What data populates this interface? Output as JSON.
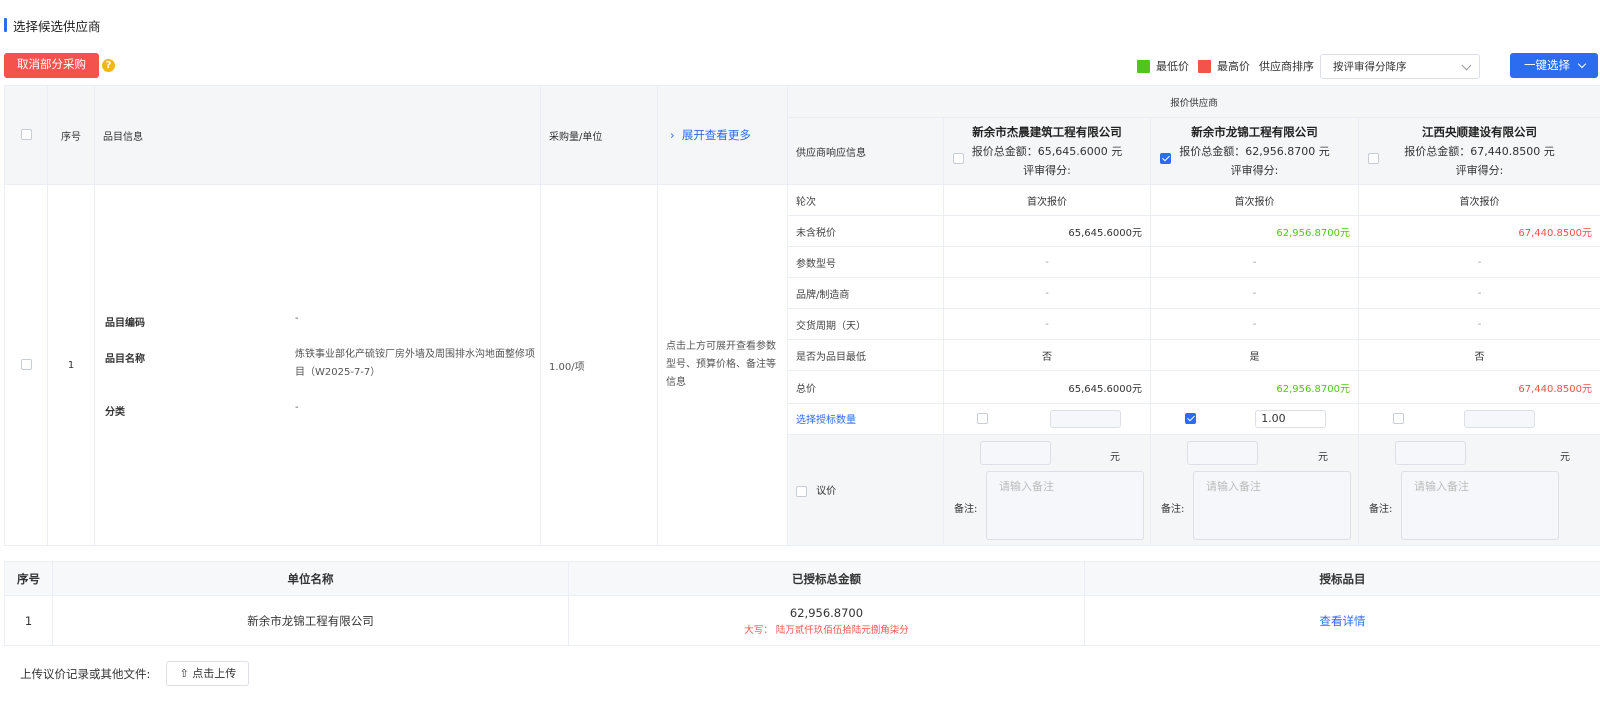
{
  "section_title": "选择候选供应商",
  "toolbar": {
    "cancel_label": "取消部分采购",
    "help_glyph": "?",
    "legend_low": "最低价",
    "legend_high": "最高价",
    "sort_label": "供应商排序",
    "sort_value": "按评审得分降序",
    "one_click_label": "一键选择",
    "colors": {
      "low": "#52c41a",
      "high": "#f4524d",
      "accent": "#2b6cf0"
    }
  },
  "table": {
    "headers": {
      "seq": "序号",
      "item_info": "品目信息",
      "qty_unit": "采购量/单位",
      "expand": "展开查看更多",
      "quote_suppliers": "报价供应商",
      "response_info": "供应商响应信息"
    },
    "suppliers": [
      {
        "name": "新余市杰晨建筑工程有限公司",
        "amount": "报价总金额：65,645.6000 元",
        "score": "评审得分:",
        "selected": false
      },
      {
        "name": "新余市龙锦工程有限公司",
        "amount": "报价总金额：62,956.8700 元",
        "score": "评审得分:",
        "selected": true
      },
      {
        "name": "江西央顺建设有限公司",
        "amount": "报价总金额：67,440.8500 元",
        "score": "评审得分:",
        "selected": false
      }
    ],
    "row": {
      "seq": "1",
      "item_code_label": "品目编码",
      "item_code": "-",
      "item_name_label": "品目名称",
      "item_name": "炼铁事业部化产硫铵厂房外墙及周围排水沟地面整修项目（W2025-7-7）",
      "category_label": "分类",
      "category": "-",
      "qty": "1.00/项",
      "hint": "点击上方可展开查看参数型号、预算价格、备注等信息"
    },
    "detail_rows": [
      {
        "label": "轮次",
        "values": [
          "首次报价",
          "首次报价",
          "首次报价"
        ]
      },
      {
        "label": "未含税价",
        "values": [
          "65,645.6000元",
          "62,956.8700元",
          "67,440.8500元"
        ]
      },
      {
        "label": "参数型号",
        "values": [
          "-",
          "-",
          "-"
        ]
      },
      {
        "label": "品牌/制造商",
        "values": [
          "-",
          "-",
          "-"
        ]
      },
      {
        "label": "交货周期（天）",
        "values": [
          "-",
          "-",
          "-"
        ]
      },
      {
        "label": "是否为品目最低",
        "values": [
          "否",
          "是",
          "否"
        ]
      },
      {
        "label": "总价",
        "values": [
          "65,645.6000元",
          "62,956.8700元",
          "67,440.8500元"
        ]
      }
    ],
    "award_qty_label": "选择授标数量",
    "award_qty_values": [
      "",
      "1.00",
      ""
    ],
    "negotiate_label": "议价",
    "yuan": "元",
    "remark_label": "备注:",
    "remark_placeholder": "请输入备注"
  },
  "summary": {
    "headers": [
      "序号",
      "单位名称",
      "已授标总金额",
      "授标品目"
    ],
    "rows": [
      {
        "seq": "1",
        "company": "新余市龙锦工程有限公司",
        "amount": "62,956.8700",
        "caps": "大写： 陆万贰仟玖佰伍拾陆元捌角柒分",
        "link": "查看详情"
      }
    ]
  },
  "upload": {
    "label": "上传议价记录或其他文件:",
    "button": "点击上传"
  }
}
